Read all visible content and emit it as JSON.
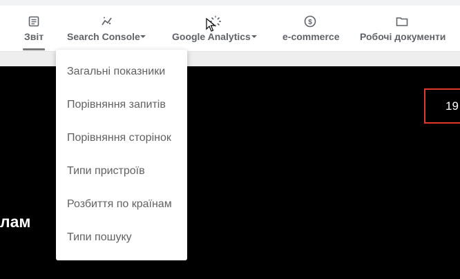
{
  "nav": {
    "tabs": [
      {
        "label": "Звіт",
        "icon": "report-icon",
        "active": true
      },
      {
        "label": "Search Console",
        "icon": "insights-icon",
        "has_dropdown": true
      },
      {
        "label": "Google Analytics",
        "icon": "analytics-icon",
        "has_dropdown": true
      },
      {
        "label": "e-commerce",
        "icon": "dollar-icon"
      },
      {
        "label": "Робочі документи",
        "icon": "folder-icon"
      }
    ]
  },
  "dropdown": {
    "items": [
      "Загальні показники",
      "Порівняння запитів",
      "Порівняння сторінок",
      "Типи пристроїв",
      "Розбиття по країнам",
      "Типи пошуку"
    ]
  },
  "content": {
    "date_fragment": "19",
    "heading_fragment": "лам"
  },
  "colors": {
    "accent_border": "#e0392b",
    "background_dark": "#000000",
    "nav_text": "#5f6368"
  }
}
